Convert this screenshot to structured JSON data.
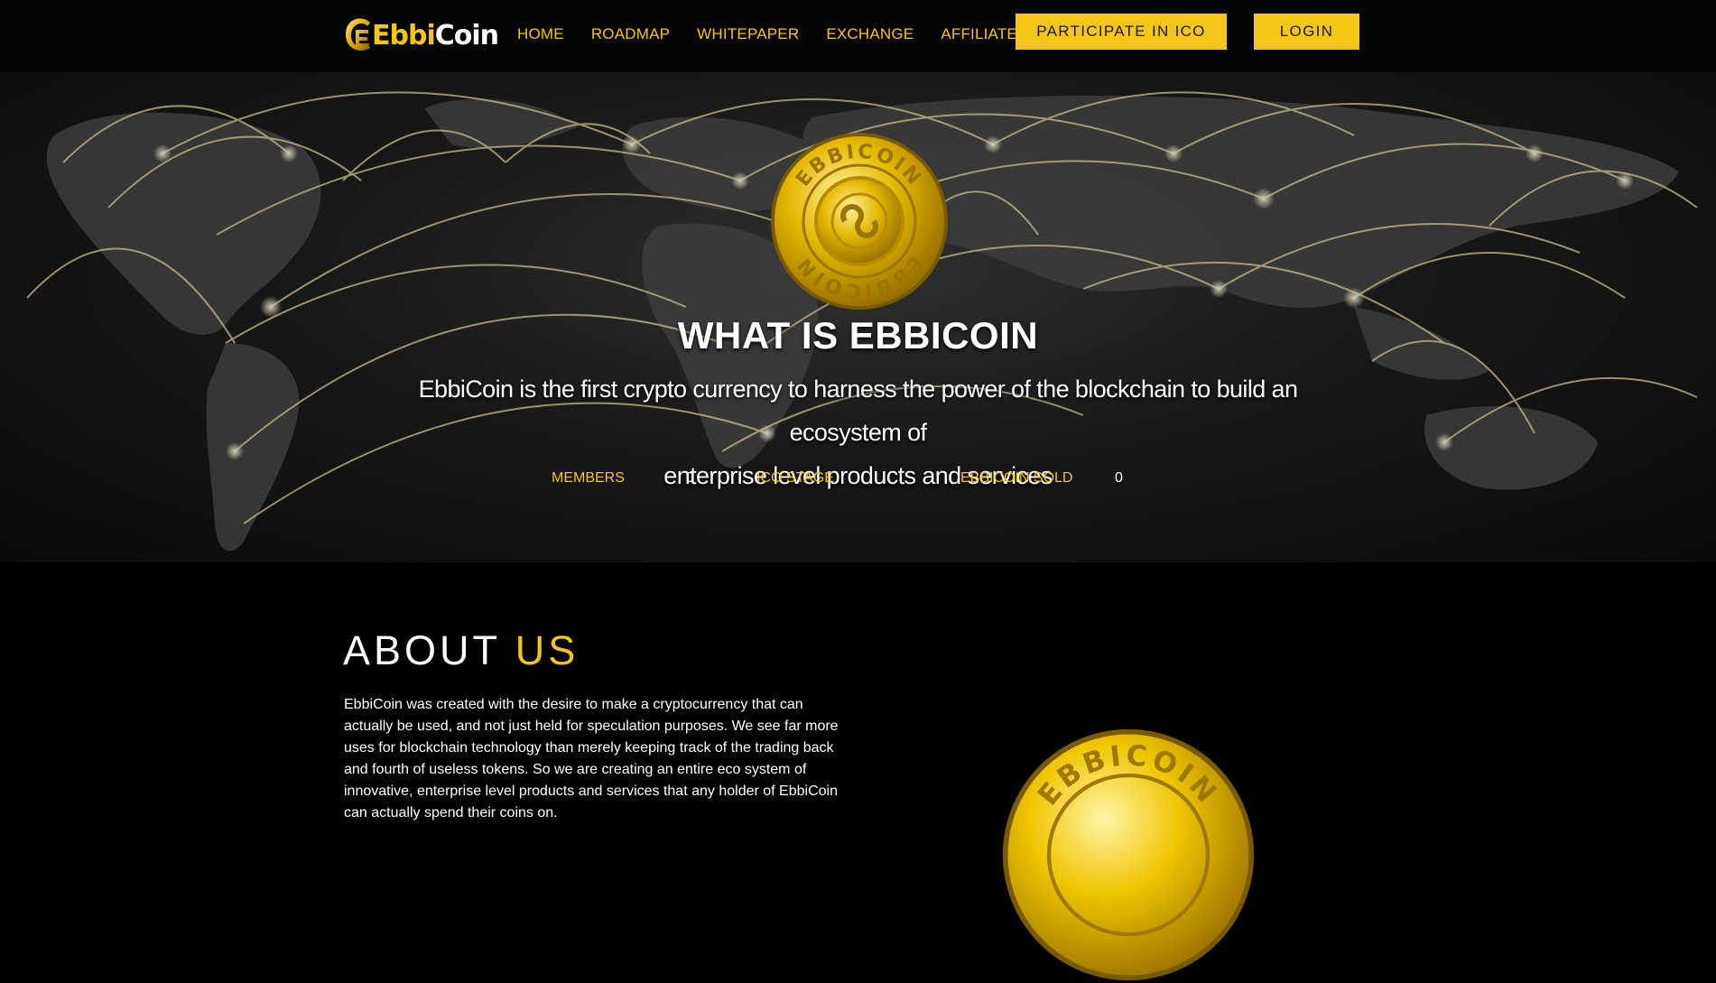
{
  "nav": {
    "logo": {
      "part1": "Ebbi",
      "part2": "Coin"
    },
    "menu": [
      "HOME",
      "ROADMAP",
      "WHITEPAPER",
      "EXCHANGE",
      "AFFILIATE"
    ],
    "participate_label": "PARTICIPATE IN ICO",
    "login_label": "LOGIN"
  },
  "hero": {
    "coin_text": "EBBICOIN",
    "title": "WHAT IS EBBICOIN",
    "subtitle_line1": "EbbiCoin is the first crypto currency to harness the power of the blockchain to build an ecosystem of",
    "subtitle_line2": "enterprise level products and services",
    "stats": {
      "members_label": "MEMBERS",
      "members_value": "0",
      "ico_stage_label": "ICO STAGE",
      "ico_stage_value": "",
      "sold_label": "EBBICOIN SOLD",
      "sold_value": "0"
    }
  },
  "about": {
    "title_part1": "ABOUT",
    "title_part2": "US",
    "lines": [
      "EbbiCoin was created with the desire to make a cryptocurrency that can",
      "actually be used, and not just held for speculation purposes. We see far more",
      "uses for blockchain technology than merely keeping track of the trading back",
      "and fourth of useless tokens. So we are creating an entire eco system of",
      "innovative, enterprise level products and services that any holder of EbbiCoin",
      "can actually spend their coins on."
    ]
  },
  "colors": {
    "accent": "#f5c518",
    "background": "#000000",
    "nav_background": "#050505"
  }
}
